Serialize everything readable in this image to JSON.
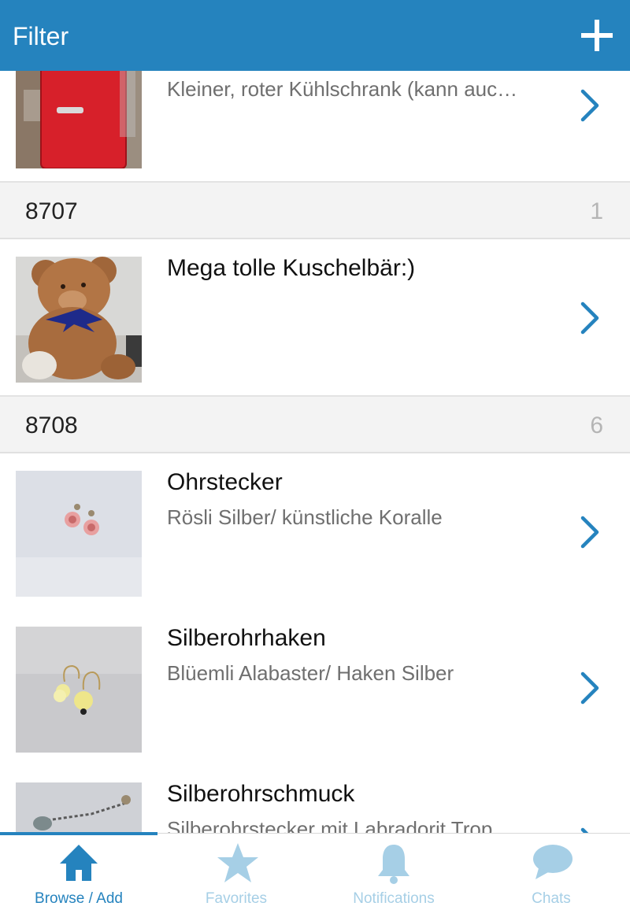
{
  "header": {
    "title": "Filter",
    "add_icon": "plus-icon"
  },
  "list": {
    "items_top": [
      {
        "title": "",
        "subtitle": "Kleiner, roter Kühlschrank (kann auc…",
        "image": "red mini fridge photo"
      }
    ],
    "sections": [
      {
        "label": "8707",
        "count": "1",
        "items": [
          {
            "title": "Mega tolle Kuschelbär:)",
            "subtitle": "",
            "image": "teddy bear photo"
          }
        ]
      },
      {
        "label": "8708",
        "count": "6",
        "items": [
          {
            "title": "Ohrstecker",
            "subtitle": "Rösli Silber/ künstliche Koralle",
            "image": "rose earrings photo"
          },
          {
            "title": "Silberohrhaken",
            "subtitle": "Blüemli Alabaster/ Haken Silber",
            "image": "yellow flower earrings photo"
          },
          {
            "title": "Silberohrschmuck",
            "subtitle": "Silberohrstecker mit Labradorit Trop",
            "image": "chain earring photo"
          }
        ]
      }
    ]
  },
  "tabbar": {
    "tabs": [
      {
        "label": "Browse / Add",
        "icon": "home-icon",
        "active": true
      },
      {
        "label": "Favorites",
        "icon": "star-icon",
        "active": false
      },
      {
        "label": "Notifications",
        "icon": "bell-icon",
        "active": false
      },
      {
        "label": "Chats",
        "icon": "chat-bubble-icon",
        "active": false
      }
    ]
  },
  "colors": {
    "accent": "#2583be",
    "inactive_tab": "#a6cfe6",
    "section_bg": "#f3f3f3"
  }
}
